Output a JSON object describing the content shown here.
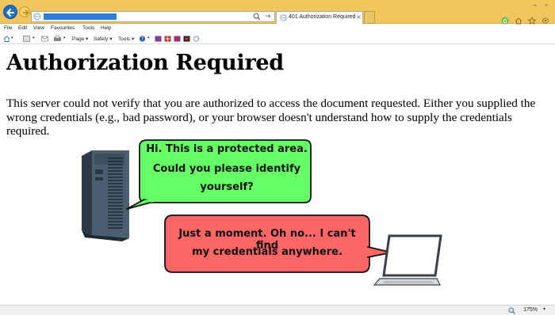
{
  "browser": {
    "tab_title": "401 Authorization Required",
    "tab_close": "×",
    "window_controls": [
      "–",
      "▫"
    ],
    "colors": {
      "titlebar": "#f2c65e",
      "address_highlight": "#2f7fd8",
      "back_button": "#1e6fc7"
    }
  },
  "menu": {
    "items": [
      "File",
      "Edit",
      "View",
      "Favourites",
      "Tools",
      "Help"
    ]
  },
  "command_bar": {
    "page_label": "Page ▾",
    "safety_label": "Safety ▾",
    "tools_label": "Tools ▾"
  },
  "page": {
    "title": "Authorization Required",
    "body": "This server could not verify that you are authorized to access the document requested. Either you supplied the wrong credentials (e.g., bad password), or your browser doesn't understand how to supply the credentials required."
  },
  "illustration": {
    "server_bubble": {
      "lines": [
        "Hi. This is a protected area.",
        "Could you please identify",
        "yourself?"
      ],
      "color": "#66ff66"
    },
    "client_bubble": {
      "lines": [
        "Just a moment. Oh no... I can't find",
        "my credentials anywhere."
      ],
      "color": "#ff6666"
    }
  },
  "status": {
    "zoom": "175%"
  }
}
